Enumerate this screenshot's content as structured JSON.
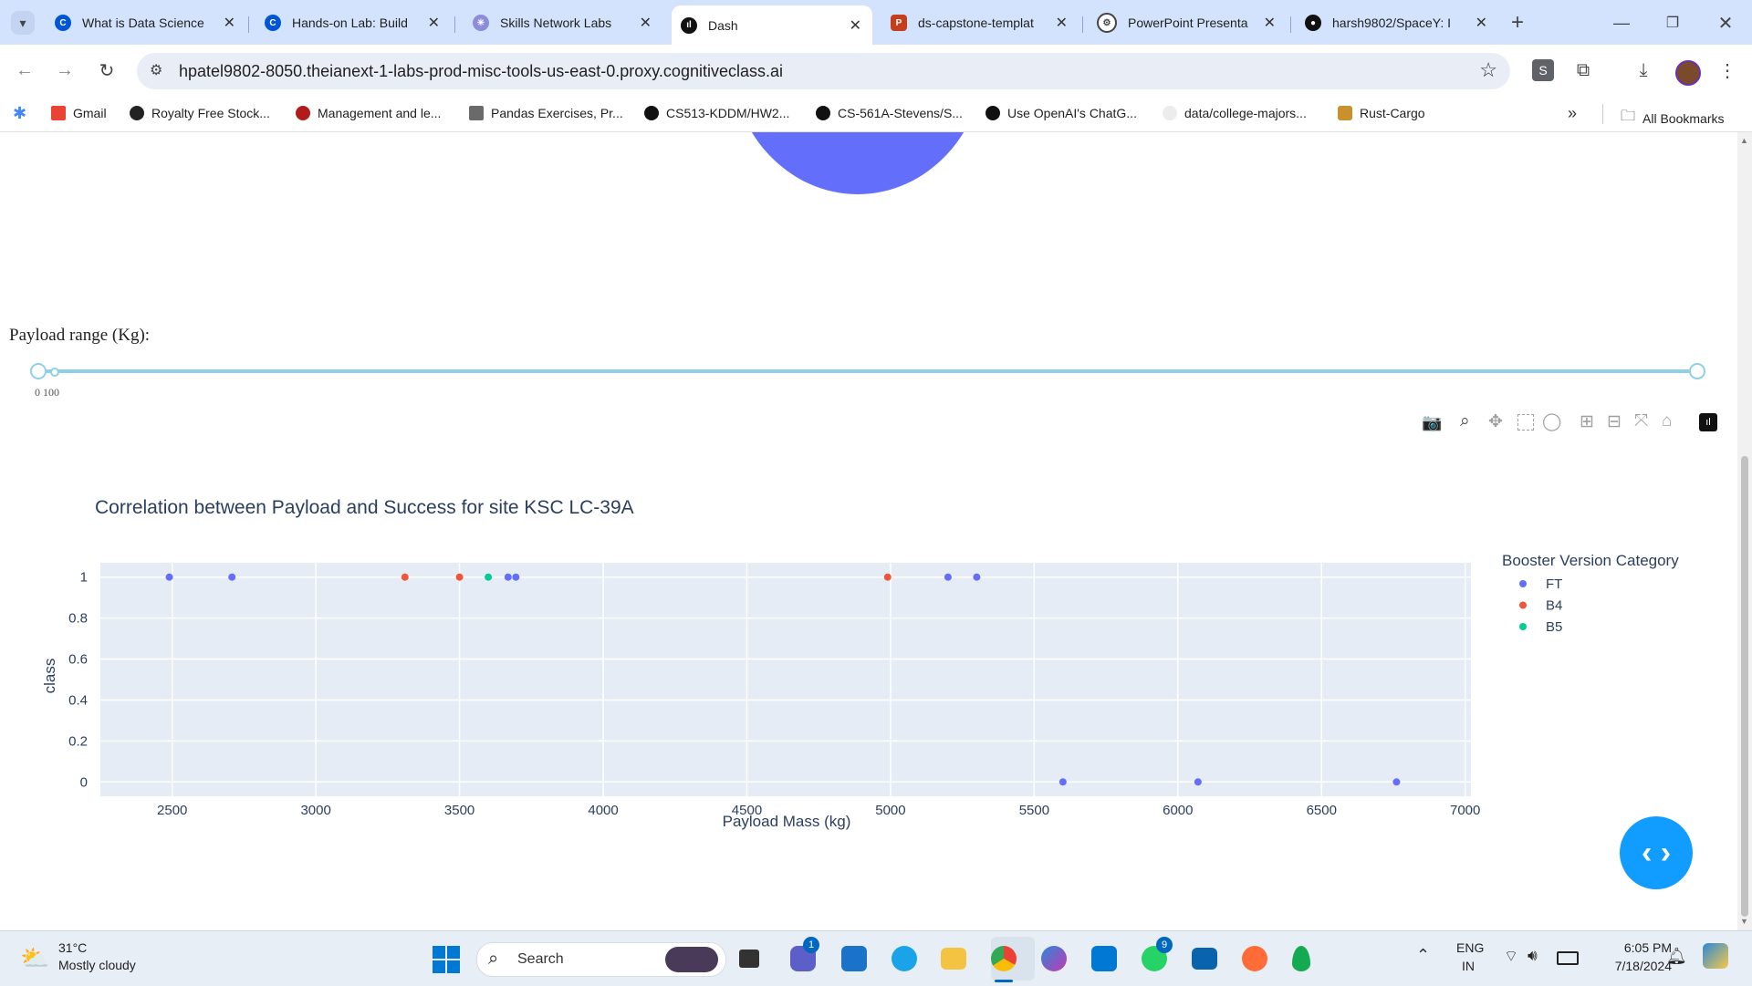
{
  "browser": {
    "tabs": [
      {
        "title": "What is Data Science",
        "icon": "coursera-icon",
        "color": "#0056d2"
      },
      {
        "title": "Hands-on Lab: Build",
        "icon": "coursera-icon",
        "color": "#0056d2"
      },
      {
        "title": "Skills Network Labs",
        "icon": "skills-network-icon",
        "color": "#8c8cd9"
      },
      {
        "title": "Dash",
        "icon": "dash-icon",
        "color": "#111111"
      },
      {
        "title": "ds-capstone-templat",
        "icon": "powerpoint-icon",
        "color": "#c43e1c"
      },
      {
        "title": "PowerPoint Presenta",
        "icon": "openai-icon",
        "color": "#444444"
      },
      {
        "title": "harsh9802/SpaceY: I",
        "icon": "github-icon",
        "color": "#111111"
      }
    ],
    "active_tab": 3,
    "url": "hpatel9802-8050.theianext-1-labs-prod-misc-tools-us-east-0.proxy.cognitiveclass.ai",
    "profile_letter": "S",
    "bookmarks": [
      {
        "label": "Gmail",
        "color": "#ea4335"
      },
      {
        "label": "Royalty Free Stock...",
        "color": "#222222"
      },
      {
        "label": "Management and le...",
        "color": "#b31b1b"
      },
      {
        "label": "Pandas Exercises, Pr...",
        "color": "#6a6a6a"
      },
      {
        "label": "CS513-KDDM/HW2...",
        "color": "#111111"
      },
      {
        "label": "CS-561A-Stevens/S...",
        "color": "#111111"
      },
      {
        "label": "Use OpenAI's ChatG...",
        "color": "#111111"
      },
      {
        "label": "data/college-majors...",
        "color": "#dddddd"
      },
      {
        "label": "Rust-Cargo",
        "color": "#c8912b"
      }
    ],
    "all_bookmarks": "All Bookmarks"
  },
  "dashboard": {
    "slider_label": "Payload range (Kg):",
    "slider_marks": "0 100",
    "slider_value": [
      0,
      1
    ],
    "pie_color": "#636efa"
  },
  "chart_data": {
    "type": "scatter",
    "title": "Correlation between Payload and Success for site KSC LC-39A",
    "xlabel": "Payload Mass (kg)",
    "ylabel": "class",
    "xlim": [
      2250,
      7020
    ],
    "ylim": [
      -0.07,
      1.07
    ],
    "xticks": [
      2500,
      3000,
      3500,
      4000,
      4500,
      5000,
      5500,
      6000,
      6500,
      7000
    ],
    "yticks": [
      0,
      0.2,
      0.4,
      0.6,
      0.8,
      1
    ],
    "grid": true,
    "legend_title": "Booster Version Category",
    "legend_position": "right",
    "series": [
      {
        "name": "FT",
        "color": "#636efa",
        "points": [
          [
            2490,
            1
          ],
          [
            2708,
            1
          ],
          [
            3669,
            1
          ],
          [
            3696,
            1
          ],
          [
            5200,
            1
          ],
          [
            5300,
            1
          ],
          [
            5600,
            0
          ],
          [
            6070,
            0
          ],
          [
            6761,
            0
          ]
        ]
      },
      {
        "name": "B4",
        "color": "#ef553b",
        "points": [
          [
            3310,
            1
          ],
          [
            3500,
            1
          ],
          [
            4990,
            1
          ]
        ]
      },
      {
        "name": "B5",
        "color": "#00cc96",
        "points": [
          [
            3600,
            1
          ]
        ]
      }
    ]
  },
  "taskbar": {
    "weather_temp": "31°C",
    "weather_desc": "Mostly cloudy",
    "search_placeholder": "Search",
    "lang_top": "ENG",
    "lang_bottom": "IN",
    "time": "6:05 PM",
    "date": "7/18/2024",
    "badge_chat": "1",
    "badge_whatsapp": "9"
  }
}
